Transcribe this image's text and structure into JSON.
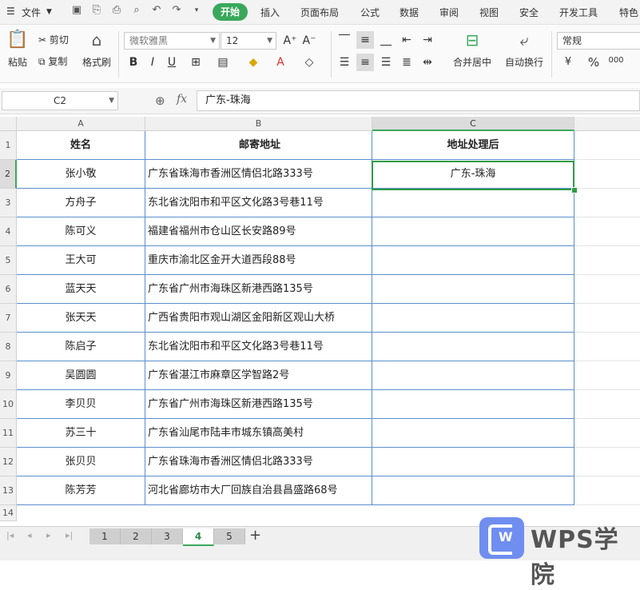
{
  "menu": {
    "file_label": "文件",
    "tabs": [
      "开始",
      "插入",
      "页面布局",
      "公式",
      "数据",
      "审阅",
      "视图",
      "安全",
      "开发工具",
      "特色"
    ]
  },
  "ribbon": {
    "paste": "粘贴",
    "cut": "剪切",
    "copy": "复制",
    "format_painter": "格式刷",
    "font_name": "微软雅黑",
    "font_size": "12",
    "bold": "B",
    "italic": "I",
    "underline": "U",
    "merge_center": "合并居中",
    "wrap_text": "自动换行",
    "number_format": "常规",
    "percent": "%",
    "currency": "¥",
    "thousands": "000"
  },
  "formula_bar": {
    "cell_ref": "C2",
    "fx": "fx",
    "value": "广东-珠海"
  },
  "columns": [
    "A",
    "B",
    "C"
  ],
  "rows": [
    "1",
    "2",
    "3",
    "4",
    "5",
    "6",
    "7",
    "8",
    "9",
    "10",
    "11",
    "12",
    "13",
    "14"
  ],
  "table": {
    "headers": [
      "姓名",
      "邮寄地址",
      "地址处理后"
    ],
    "rows": [
      {
        "name": "张小敬",
        "address": "广东省珠海市香洲区情侣北路333号",
        "result": "广东-珠海"
      },
      {
        "name": "方舟子",
        "address": "东北省沈阳市和平区文化路3号巷11号",
        "result": ""
      },
      {
        "name": "陈可义",
        "address": "福建省福州市仓山区长安路89号",
        "result": ""
      },
      {
        "name": "王大可",
        "address": "重庆市渝北区金开大道西段88号",
        "result": ""
      },
      {
        "name": "蓝天天",
        "address": "广东省广州市海珠区新港西路135号",
        "result": ""
      },
      {
        "name": "张天天",
        "address": "广西省贵阳市观山湖区金阳新区观山大桥",
        "result": ""
      },
      {
        "name": "陈启子",
        "address": "东北省沈阳市和平区文化路3号巷11号",
        "result": ""
      },
      {
        "name": "吴圆圆",
        "address": "广东省湛江市麻章区学智路2号",
        "result": ""
      },
      {
        "name": "李贝贝",
        "address": "广东省广州市海珠区新港西路135号",
        "result": ""
      },
      {
        "name": "苏三十",
        "address": "广东省汕尾市陆丰市城东镇高美村",
        "result": ""
      },
      {
        "name": "张贝贝",
        "address": "广东省珠海市香洲区情侣北路333号",
        "result": ""
      },
      {
        "name": "陈芳芳",
        "address": "河北省廊坊市大厂回族自治县昌盛路68号",
        "result": ""
      }
    ]
  },
  "sheets": [
    "1",
    "2",
    "3",
    "4",
    "5"
  ],
  "active_sheet": "4",
  "add_sheet": "+",
  "watermark": "WPS学院",
  "colors": {
    "accent": "#3aa85c",
    "grid_line": "#5b8fcf",
    "selection": "#2f9b47"
  }
}
